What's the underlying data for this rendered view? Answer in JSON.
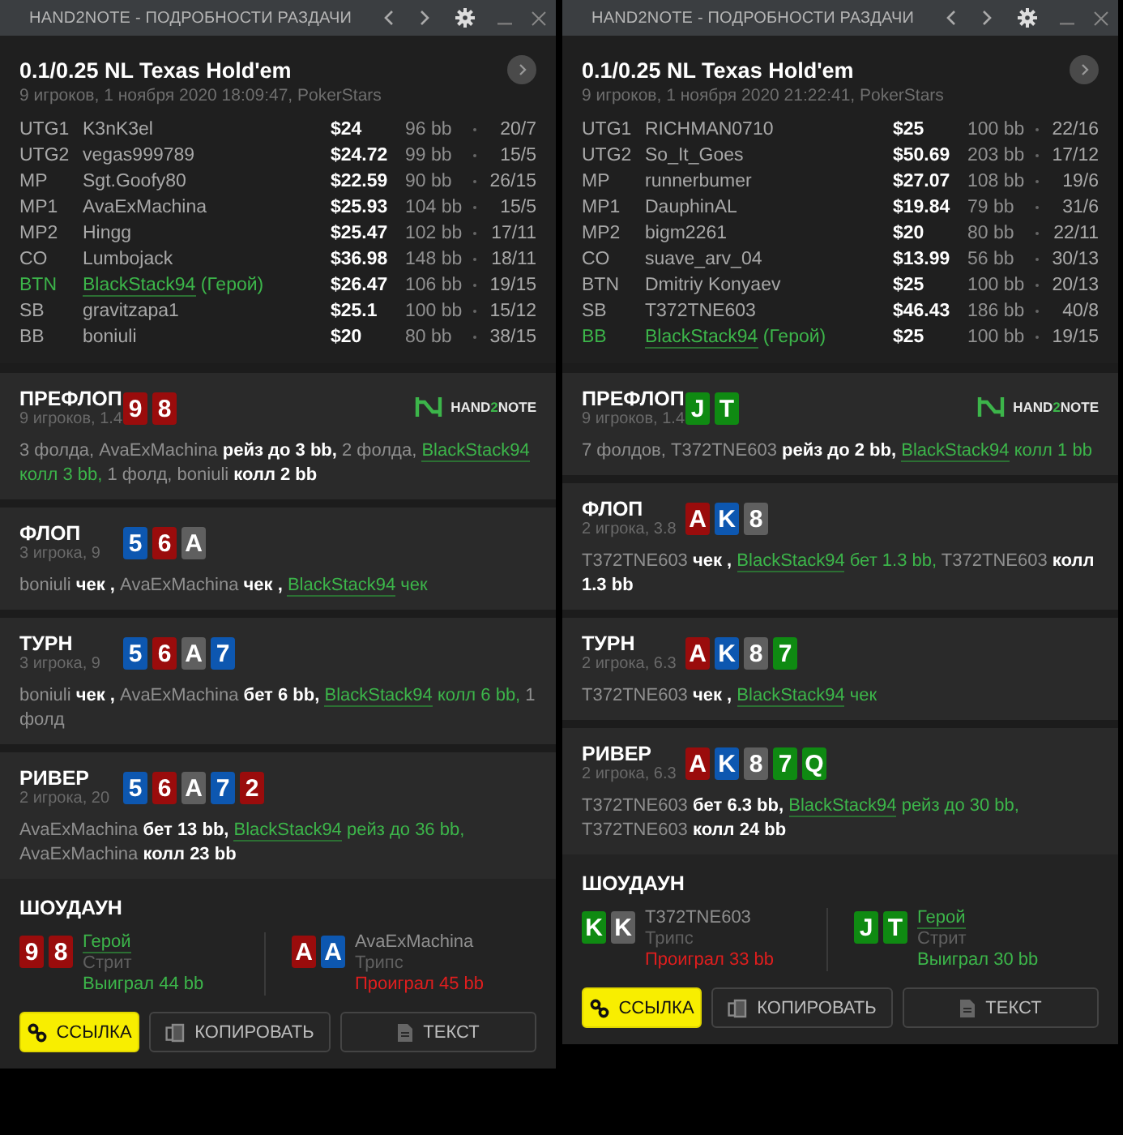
{
  "windows": [
    {
      "title": "HAND2NOTE - ПОДРОБНОСТИ РАЗДАЧИ",
      "hand_title": "0.1/0.25 NL Texas Hold'em",
      "subtitle": "9 игроков, 1 ноября 2020 18:09:47, PokerStars",
      "players": [
        {
          "position": "UTG1",
          "name": "K3nK3el",
          "hero": false,
          "stack": "$24",
          "bb": "96 bb",
          "stats": "20/7"
        },
        {
          "position": "UTG2",
          "name": "vegas999789",
          "hero": false,
          "stack": "$24.72",
          "bb": "99 bb",
          "stats": "15/5"
        },
        {
          "position": "MP",
          "name": "Sgt.Goofy80",
          "hero": false,
          "stack": "$22.59",
          "bb": "90 bb",
          "stats": "26/15"
        },
        {
          "position": "MP1",
          "name": "AvaExMachina",
          "hero": false,
          "stack": "$25.93",
          "bb": "104 bb",
          "stats": "15/5"
        },
        {
          "position": "MP2",
          "name": "Hingg",
          "hero": false,
          "stack": "$25.47",
          "bb": "102 bb",
          "stats": "17/11"
        },
        {
          "position": "CO",
          "name": "Lumbojack",
          "hero": false,
          "stack": "$36.98",
          "bb": "148 bb",
          "stats": "18/11"
        },
        {
          "position": "BTN",
          "name": "BlackStack94",
          "hero": true,
          "tag": "(Герой)",
          "stack": "$26.47",
          "bb": "106 bb",
          "stats": "19/15"
        },
        {
          "position": "SB",
          "name": "gravitzapa1",
          "hero": false,
          "stack": "$25.1",
          "bb": "100 bb",
          "stats": "15/12"
        },
        {
          "position": "BB",
          "name": "boniuli",
          "hero": false,
          "stack": "$20",
          "bb": "80 bb",
          "stats": "38/15"
        }
      ],
      "streets": [
        {
          "name": "ПРЕФЛОП",
          "info": "9 игроков, 1.4",
          "logo": [
            "HAND",
            "2",
            "NOTE"
          ],
          "cards": [
            {
              "rank": "9",
              "color": "#9a0c0c"
            },
            {
              "rank": "8",
              "color": "#9a0c0c"
            }
          ],
          "actions": [
            {
              "kind": "text",
              "text": "3 фолда, AvaExMachina"
            },
            {
              "kind": "action",
              "text": " рейз до 3 bb,"
            },
            {
              "kind": "text",
              "text": " 2 фолда, "
            },
            {
              "kind": "hero",
              "text": "BlackStack94"
            },
            {
              "kind": "hero_action",
              "text": " колл 3 bb,"
            },
            {
              "kind": "text",
              "text": " 1 фолд, boniuli"
            },
            {
              "kind": "action",
              "text": " колл 2 bb"
            }
          ]
        },
        {
          "name": "ФЛОП",
          "info": "3 игрока, 9",
          "cards": [
            {
              "rank": "5",
              "color": "#0d57b0"
            },
            {
              "rank": "6",
              "color": "#9a0c0c"
            },
            {
              "rank": "A",
              "color": "#5f5f5f"
            }
          ],
          "actions": [
            {
              "kind": "text",
              "text": "boniuli"
            },
            {
              "kind": "action",
              "text": " чек ,"
            },
            {
              "kind": "text",
              "text": " AvaExMachina"
            },
            {
              "kind": "action",
              "text": " чек , "
            },
            {
              "kind": "hero",
              "text": "BlackStack94"
            },
            {
              "kind": "hero_action",
              "text": " чек"
            }
          ]
        },
        {
          "name": "ТУРН",
          "info": "3 игрока, 9",
          "cards": [
            {
              "rank": "5",
              "color": "#0d57b0"
            },
            {
              "rank": "6",
              "color": "#9a0c0c"
            },
            {
              "rank": "A",
              "color": "#5f5f5f"
            },
            {
              "rank": "7",
              "color": "#0d57b0"
            }
          ],
          "actions": [
            {
              "kind": "text",
              "text": "boniuli"
            },
            {
              "kind": "action",
              "text": " чек ,"
            },
            {
              "kind": "text",
              "text": " AvaExMachina"
            },
            {
              "kind": "action",
              "text": " бет 6 bb, "
            },
            {
              "kind": "hero",
              "text": "BlackStack94"
            },
            {
              "kind": "hero_action",
              "text": " колл 6 bb,"
            },
            {
              "kind": "text",
              "text": " 1 фолд"
            }
          ]
        },
        {
          "name": "РИВЕР",
          "info": "2 игрока, 20",
          "cards": [
            {
              "rank": "5",
              "color": "#0d57b0"
            },
            {
              "rank": "6",
              "color": "#9a0c0c"
            },
            {
              "rank": "A",
              "color": "#5f5f5f"
            },
            {
              "rank": "7",
              "color": "#0d57b0"
            },
            {
              "rank": "2",
              "color": "#9a0c0c"
            }
          ],
          "actions": [
            {
              "kind": "text",
              "text": "AvaExMachina"
            },
            {
              "kind": "action",
              "text": " бет 13 bb, "
            },
            {
              "kind": "hero",
              "text": "BlackStack94"
            },
            {
              "kind": "hero_action",
              "text": " рейз до 36 bb,"
            },
            {
              "kind": "text",
              "text": " AvaExMachina"
            },
            {
              "kind": "action",
              "text": " колл 23 bb"
            }
          ]
        }
      ],
      "showdown": {
        "title": "ШОУДАУН",
        "hands": [
          {
            "cards": [
              {
                "rank": "9",
                "color": "#9a0c0c"
              },
              {
                "rank": "8",
                "color": "#9a0c0c"
              }
            ],
            "name": "Герой",
            "hero": true,
            "combo": "Стрит",
            "result": "Выиграл 44 bb",
            "won": true
          },
          {
            "cards": [
              {
                "rank": "A",
                "color": "#9a0c0c"
              },
              {
                "rank": "A",
                "color": "#0d57b0"
              }
            ],
            "name": "AvaExMachina",
            "hero": false,
            "combo": "Трипс",
            "result": "Проиграл 45 bb",
            "won": false
          }
        ]
      },
      "buttons": [
        {
          "kind": "link",
          "label": "ССЫЛКА"
        },
        {
          "kind": "copy",
          "label": "КОПИРОВАТЬ"
        },
        {
          "kind": "text",
          "label": "ТЕКСТ"
        }
      ]
    },
    {
      "title": "HAND2NOTE - ПОДРОБНОСТИ РАЗДАЧИ",
      "hand_title": "0.1/0.25 NL Texas Hold'em",
      "subtitle": "9 игроков, 1 ноября 2020 21:22:41, PokerStars",
      "players": [
        {
          "position": "UTG1",
          "name": "RICHMAN0710",
          "hero": false,
          "stack": "$25",
          "bb": "100 bb",
          "stats": "22/16"
        },
        {
          "position": "UTG2",
          "name": "So_It_Goes",
          "hero": false,
          "stack": "$50.69",
          "bb": "203 bb",
          "stats": "17/12"
        },
        {
          "position": "MP",
          "name": "runnerbumer",
          "hero": false,
          "stack": "$27.07",
          "bb": "108 bb",
          "stats": "19/6"
        },
        {
          "position": "MP1",
          "name": "DauphinAL",
          "hero": false,
          "stack": "$19.84",
          "bb": "79 bb",
          "stats": "31/6"
        },
        {
          "position": "MP2",
          "name": "bigm2261",
          "hero": false,
          "stack": "$20",
          "bb": "80 bb",
          "stats": "22/11"
        },
        {
          "position": "CO",
          "name": "suave_arv_04",
          "hero": false,
          "stack": "$13.99",
          "bb": "56 bb",
          "stats": "30/13"
        },
        {
          "position": "BTN",
          "name": "Dmitriy Konyaev",
          "hero": false,
          "stack": "$25",
          "bb": "100 bb",
          "stats": "20/13"
        },
        {
          "position": "SB",
          "name": "T372TNE603",
          "hero": false,
          "stack": "$46.43",
          "bb": "186 bb",
          "stats": "40/8"
        },
        {
          "position": "BB",
          "name": "BlackStack94",
          "hero": true,
          "tag": "(Герой)",
          "stack": "$25",
          "bb": "100 bb",
          "stats": "19/15"
        }
      ],
      "streets": [
        {
          "name": "ПРЕФЛОП",
          "info": "9 игроков, 1.4",
          "logo": [
            "HAND",
            "2",
            "NOTE"
          ],
          "cards": [
            {
              "rank": "J",
              "color": "#0f8a12"
            },
            {
              "rank": "T",
              "color": "#0f8a12"
            }
          ],
          "actions": [
            {
              "kind": "text",
              "text": "7 фолдов, T372TNE603"
            },
            {
              "kind": "action",
              "text": " рейз до 2 bb, "
            },
            {
              "kind": "hero",
              "text": "BlackStack94"
            },
            {
              "kind": "hero_action",
              "text": " колл 1 bb"
            }
          ]
        },
        {
          "name": "ФЛОП",
          "info": "2 игрока, 3.8",
          "cards": [
            {
              "rank": "A",
              "color": "#9a0c0c"
            },
            {
              "rank": "K",
              "color": "#0d57b0"
            },
            {
              "rank": "8",
              "color": "#5f5f5f"
            }
          ],
          "actions": [
            {
              "kind": "text",
              "text": "T372TNE603"
            },
            {
              "kind": "action",
              "text": " чек , "
            },
            {
              "kind": "hero",
              "text": "BlackStack94"
            },
            {
              "kind": "hero_action",
              "text": " бет 1.3 bb,"
            },
            {
              "kind": "text",
              "text": " T372TNE603"
            },
            {
              "kind": "action",
              "text": " колл 1.3 bb"
            }
          ]
        },
        {
          "name": "ТУРН",
          "info": "2 игрока, 6.3",
          "cards": [
            {
              "rank": "A",
              "color": "#9a0c0c"
            },
            {
              "rank": "K",
              "color": "#0d57b0"
            },
            {
              "rank": "8",
              "color": "#5f5f5f"
            },
            {
              "rank": "7",
              "color": "#0f8a12"
            }
          ],
          "actions": [
            {
              "kind": "text",
              "text": "T372TNE603"
            },
            {
              "kind": "action",
              "text": " чек , "
            },
            {
              "kind": "hero",
              "text": "BlackStack94"
            },
            {
              "kind": "hero_action",
              "text": " чек"
            }
          ]
        },
        {
          "name": "РИВЕР",
          "info": "2 игрока, 6.3",
          "cards": [
            {
              "rank": "A",
              "color": "#9a0c0c"
            },
            {
              "rank": "K",
              "color": "#0d57b0"
            },
            {
              "rank": "8",
              "color": "#5f5f5f"
            },
            {
              "rank": "7",
              "color": "#0f8a12"
            },
            {
              "rank": "Q",
              "color": "#0f8a12"
            }
          ],
          "actions": [
            {
              "kind": "text",
              "text": "T372TNE603"
            },
            {
              "kind": "action",
              "text": " бет 6.3 bb, "
            },
            {
              "kind": "hero",
              "text": "BlackStack94"
            },
            {
              "kind": "hero_action",
              "text": " рейз до 30 bb,"
            },
            {
              "kind": "text",
              "text": " T372TNE603"
            },
            {
              "kind": "action",
              "text": " колл 24 bb"
            }
          ]
        }
      ],
      "showdown": {
        "title": "ШОУДАУН",
        "hands": [
          {
            "cards": [
              {
                "rank": "K",
                "color": "#0f8a12"
              },
              {
                "rank": "K",
                "color": "#5f5f5f"
              }
            ],
            "name": "T372TNE603",
            "hero": false,
            "combo": "Трипс",
            "result": "Проиграл 33 bb",
            "won": false
          },
          {
            "cards": [
              {
                "rank": "J",
                "color": "#0f8a12"
              },
              {
                "rank": "T",
                "color": "#0f8a12"
              }
            ],
            "name": "Герой",
            "hero": true,
            "combo": "Стрит",
            "result": "Выиграл 30 bb",
            "won": true
          }
        ]
      },
      "buttons": [
        {
          "kind": "link",
          "label": "ССЫЛКА"
        },
        {
          "kind": "copy",
          "label": "КОПИРОВАТЬ"
        },
        {
          "kind": "text",
          "label": "ТЕКСТ"
        }
      ]
    }
  ]
}
